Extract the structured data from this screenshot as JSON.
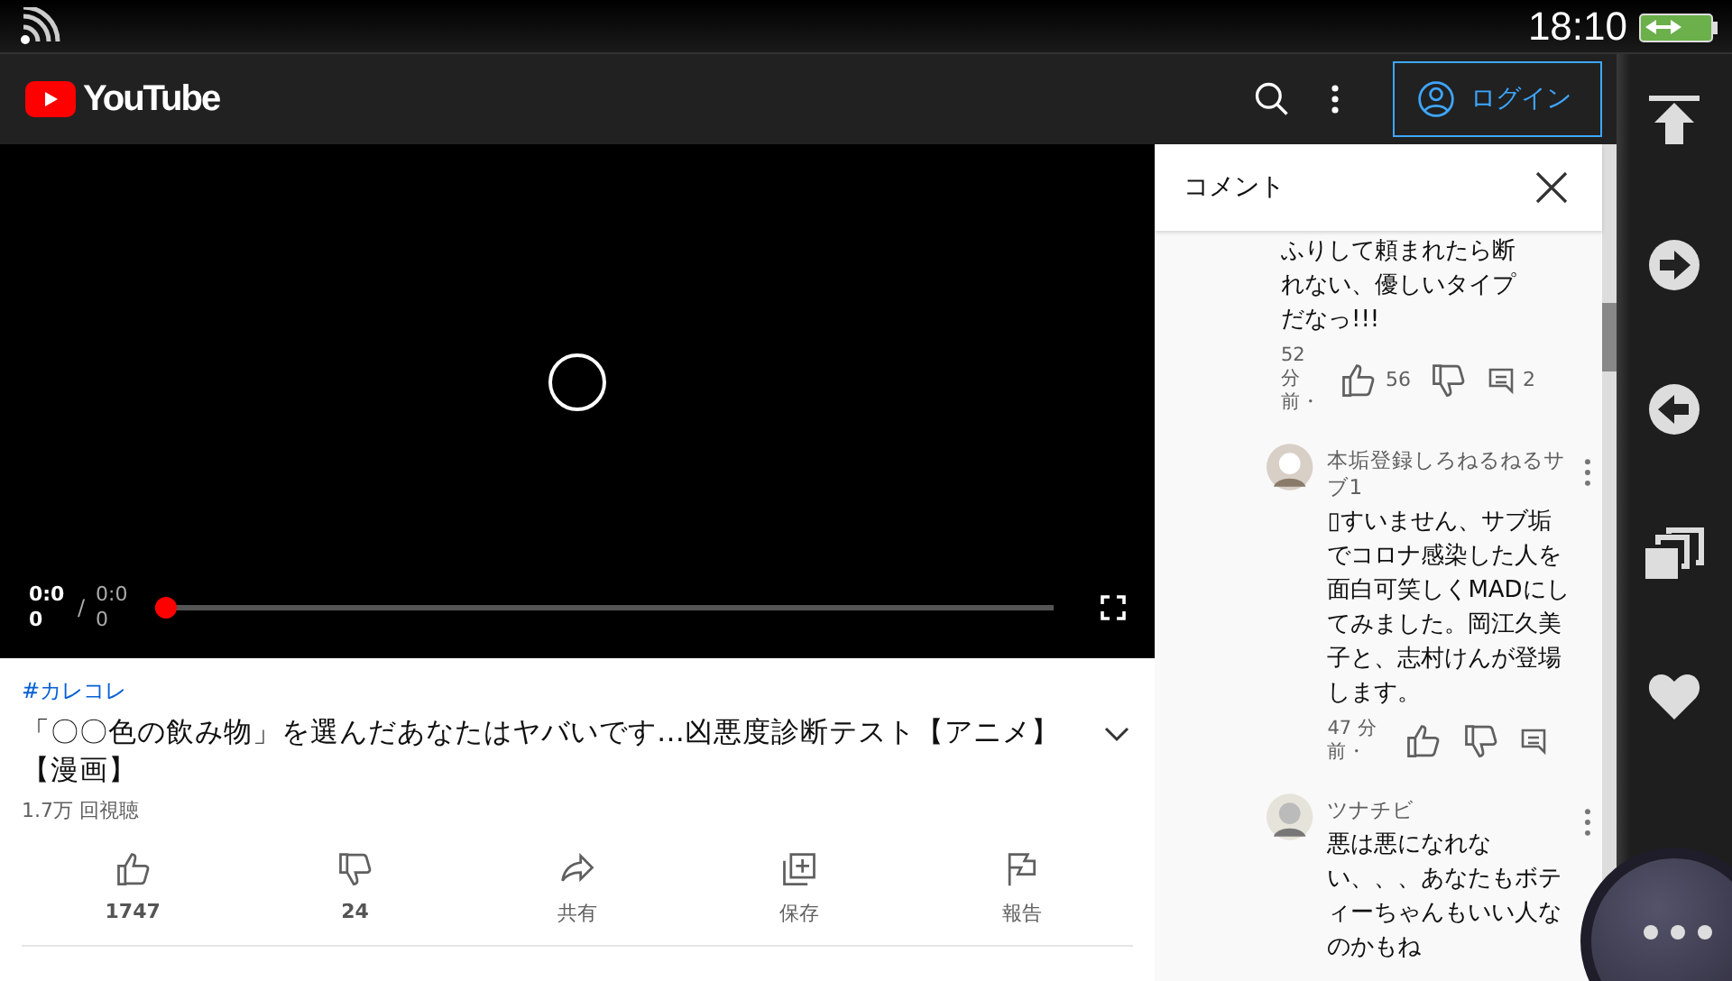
{
  "status_bar": {
    "time": "18:10"
  },
  "header": {
    "logo": "YouTube",
    "login": "ログイン"
  },
  "player": {
    "current": "0:00",
    "separator": "/",
    "duration": "0:00",
    "level": 0
  },
  "video": {
    "hashtag": "#カレコレ",
    "title": "「〇〇色の飲み物」を選んだあなたはヤバいです…凶悪度診断テスト【アニメ】【漫画】",
    "views": "1.7万 回視聴",
    "actions": [
      {
        "kind": "like",
        "label": "1747"
      },
      {
        "kind": "dislike",
        "label": "24"
      },
      {
        "kind": "share",
        "label": "共有"
      },
      {
        "kind": "save",
        "label": "保存"
      },
      {
        "kind": "report",
        "label": "報告"
      }
    ]
  },
  "comments": {
    "title": "コメント",
    "items": [
      {
        "text": "ふりして頼まれたら断れない、優しいタイプだなっ!!!",
        "time": "52 分前・",
        "likes": "56",
        "replies": "2"
      },
      {
        "author": "本垢登録しろねるねるサブ1",
        "text": "▯すいません、サブ垢でコロナ感染した人を面白可笑しくMADにしてみました。岡江久美子と、志村けんが登場します。",
        "time": "47 分前・"
      },
      {
        "author": "ツナチビ",
        "text": "悪は悪になれない、、、あなたもボティーちゃんもいい人なのかもね"
      }
    ]
  }
}
